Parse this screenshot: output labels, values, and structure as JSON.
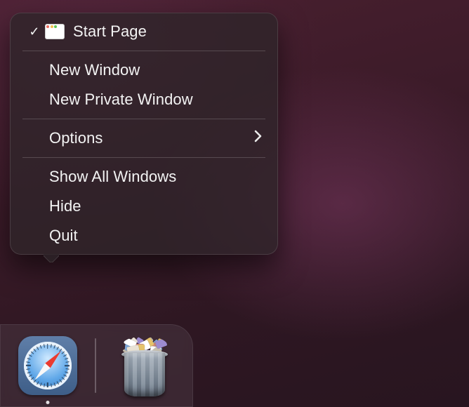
{
  "menu": {
    "start_page": {
      "label": "Start Page",
      "checked": true
    },
    "new_window": "New Window",
    "new_private_window": "New Private Window",
    "options": "Options",
    "show_all_windows": "Show All Windows",
    "hide": "Hide",
    "quit": "Quit"
  },
  "dock": {
    "safari": "Safari",
    "trash": "Trash",
    "trash_full": true
  },
  "icons": {
    "checkmark": "✓",
    "chevron_right": "›"
  },
  "colors": {
    "traffic_red": "#ec6a5e",
    "traffic_yellow": "#f4bf4f",
    "traffic_green": "#61c554"
  }
}
